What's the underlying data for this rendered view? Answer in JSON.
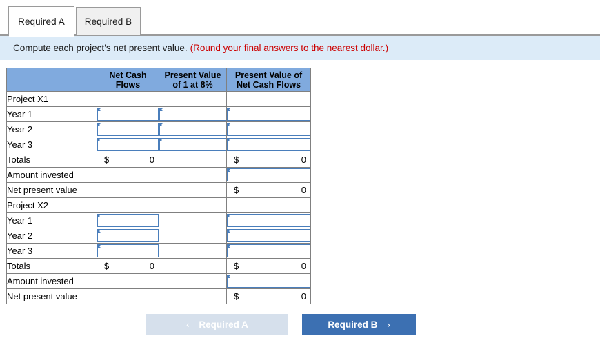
{
  "tabs": [
    {
      "label": "Required A",
      "active": true
    },
    {
      "label": "Required B",
      "active": false
    }
  ],
  "instruction": {
    "text": "Compute each project’s net present value.",
    "hint": "(Round your final answers to the nearest dollar.)"
  },
  "table": {
    "headers": [
      "",
      "Net Cash Flows",
      "Present Value of 1 at 8%",
      "Present Value of Net Cash Flows"
    ],
    "rows": [
      {
        "label": "Project X1",
        "ncf": {
          "type": "blank"
        },
        "pv1": {
          "type": "blank"
        },
        "pvncf": {
          "type": "blank"
        }
      },
      {
        "label": "Year 1",
        "ncf": {
          "type": "input"
        },
        "pv1": {
          "type": "input"
        },
        "pvncf": {
          "type": "input"
        }
      },
      {
        "label": "Year 2",
        "ncf": {
          "type": "input"
        },
        "pv1": {
          "type": "input"
        },
        "pvncf": {
          "type": "input"
        }
      },
      {
        "label": "Year 3",
        "ncf": {
          "type": "input"
        },
        "pv1": {
          "type": "input"
        },
        "pvncf": {
          "type": "input"
        }
      },
      {
        "label": "Totals",
        "ncf": {
          "type": "total",
          "currency": "$",
          "value": "0"
        },
        "pv1": {
          "type": "blank"
        },
        "pvncf": {
          "type": "total",
          "currency": "$",
          "value": "0"
        }
      },
      {
        "label": "Amount invested",
        "ncf": {
          "type": "blank"
        },
        "pv1": {
          "type": "blank"
        },
        "pvncf": {
          "type": "input"
        }
      },
      {
        "label": "Net present value",
        "ncf": {
          "type": "blank"
        },
        "pv1": {
          "type": "blank"
        },
        "pvncf": {
          "type": "total",
          "currency": "$",
          "value": "0"
        }
      },
      {
        "label": "Project X2",
        "ncf": {
          "type": "blank"
        },
        "pv1": {
          "type": "blank"
        },
        "pvncf": {
          "type": "blank"
        }
      },
      {
        "label": "Year 1",
        "ncf": {
          "type": "input"
        },
        "pv1": {
          "type": "blank"
        },
        "pvncf": {
          "type": "input"
        }
      },
      {
        "label": "Year 2",
        "ncf": {
          "type": "input"
        },
        "pv1": {
          "type": "blank"
        },
        "pvncf": {
          "type": "input"
        }
      },
      {
        "label": "Year 3",
        "ncf": {
          "type": "input"
        },
        "pv1": {
          "type": "blank"
        },
        "pvncf": {
          "type": "input"
        }
      },
      {
        "label": "Totals",
        "ncf": {
          "type": "total",
          "currency": "$",
          "value": "0"
        },
        "pv1": {
          "type": "blank"
        },
        "pvncf": {
          "type": "total",
          "currency": "$",
          "value": "0"
        }
      },
      {
        "label": "Amount invested",
        "ncf": {
          "type": "blank"
        },
        "pv1": {
          "type": "blank"
        },
        "pvncf": {
          "type": "input"
        }
      },
      {
        "label": "Net present value",
        "ncf": {
          "type": "blank"
        },
        "pv1": {
          "type": "blank"
        },
        "pvncf": {
          "type": "total",
          "currency": "$",
          "value": "0"
        }
      }
    ]
  },
  "footer": {
    "prev": {
      "label": "Required A",
      "icon": "chevron-left-icon",
      "glyph": "‹",
      "disabled": true
    },
    "next": {
      "label": "Required B",
      "icon": "chevron-right-icon",
      "glyph": "›",
      "disabled": false
    }
  },
  "colors": {
    "header_blue": "#80aade",
    "banner_blue": "#dcebf8",
    "hint_red": "#cc0000",
    "input_border": "#4a7ebb",
    "next_button": "#3c70b2",
    "prev_button": "#d6e0ec"
  }
}
